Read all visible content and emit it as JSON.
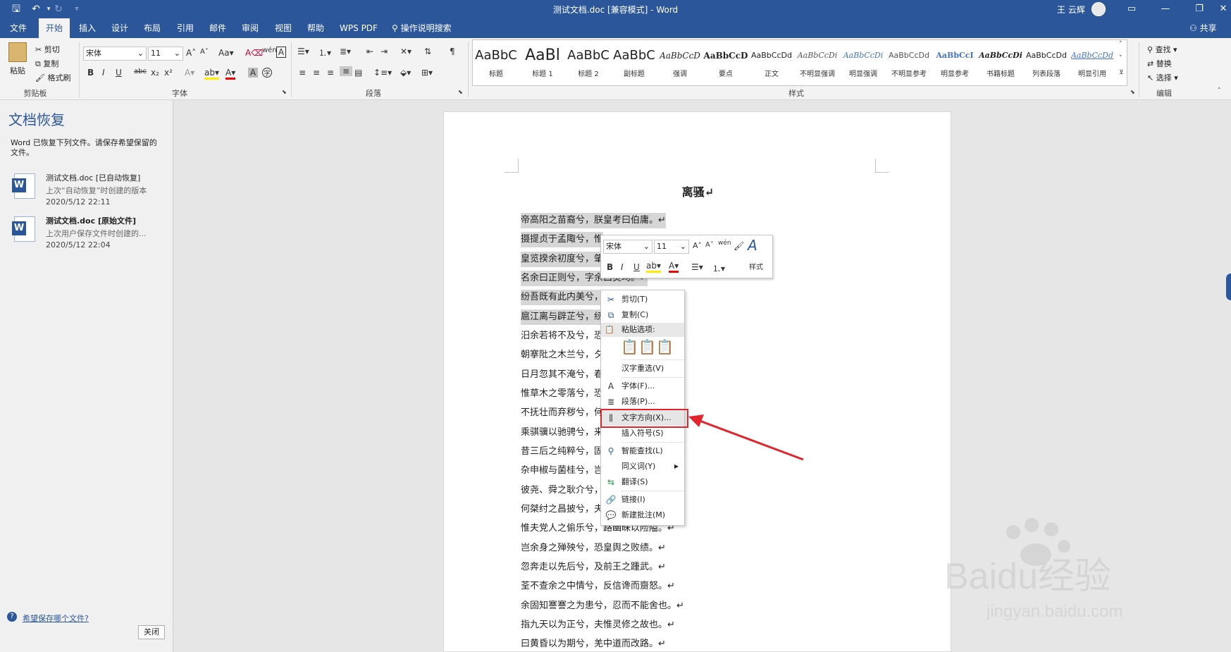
{
  "window": {
    "title": "测试文档.doc [兼容模式] - Word",
    "user": "王 云辉"
  },
  "tabs": [
    "文件",
    "开始",
    "插入",
    "设计",
    "布局",
    "引用",
    "邮件",
    "审阅",
    "视图",
    "帮助",
    "WPS PDF"
  ],
  "active_tab": "开始",
  "tell_me": "操作说明搜索",
  "share": "共享",
  "ribbon": {
    "clipboard": {
      "paste": "粘贴",
      "cut": "剪切",
      "copy": "复制",
      "format_painter": "格式刷",
      "label": "剪贴板"
    },
    "font": {
      "name": "宋体",
      "size": "11",
      "label": "字体"
    },
    "paragraph": {
      "label": "段落"
    },
    "styles": {
      "label": "样式",
      "items": [
        {
          "sample": "AaBbC",
          "name": "标题"
        },
        {
          "sample": "AaBl",
          "name": "标题 1"
        },
        {
          "sample": "AaBbC",
          "name": "标题 2"
        },
        {
          "sample": "AaBbC",
          "name": "副标题"
        },
        {
          "sample": "AaBbCcD",
          "name": "强调"
        },
        {
          "sample": "AaBbCcD",
          "name": "要点"
        },
        {
          "sample": "AaBbCcDd",
          "name": "正文"
        },
        {
          "sample": "AaBbCcDi",
          "name": "不明显强调"
        },
        {
          "sample": "AaBbCcDi",
          "name": "明显强调"
        },
        {
          "sample": "AaBbCcDd",
          "name": "不明显参考"
        },
        {
          "sample": "AaBbCcI",
          "name": "明显参考"
        },
        {
          "sample": "AaBbCcDi",
          "name": "书籍标题"
        },
        {
          "sample": "AaBbCcDd",
          "name": "列表段落"
        },
        {
          "sample": "AaBbCcDd",
          "name": "明显引用"
        }
      ]
    },
    "editing": {
      "find": "查找",
      "replace": "替换",
      "select": "选择",
      "label": "编辑"
    }
  },
  "recovery": {
    "title": "文档恢复",
    "description": "Word 已恢复下列文件。请保存希望保留的文件。",
    "items": [
      {
        "name": "测试文档.doc  [已自动恢复]",
        "sub": "上次“自动恢复”时创建的版本",
        "date": "2020/5/12 22:11"
      },
      {
        "name": "测试文档.doc  [原始文件]",
        "sub": "上次用户保存文件时创建的...",
        "date": "2020/5/12 22:04"
      }
    ],
    "help_link": "希望保存哪个文件?",
    "close": "关闭"
  },
  "document": {
    "heading": "离骚↵",
    "lines": [
      "帝高阳之苗裔兮，朕皇考曰伯庸。↵",
      "摄提贞于孟陬兮，惟",
      "皇览揆余初度兮，肇",
      "名余曰正则兮，字余曰灵均。↵",
      "纷吾既有此内美兮，",
      "扈江离与辟芷兮，纫",
      "汨余若将不及兮，恐",
      "朝搴阰之木兰兮，夕",
      "日月忽其不淹兮，春",
      "惟草木之零落兮，恐",
      "不抚壮而弃秽兮，何",
      "乘骐骥以驰骋兮，来",
      "昔三后之纯粹兮，固",
      "杂申椒与菌桂兮，岂",
      "彼尧、舜之耿介兮，",
      "何桀纣之昌披兮，夫",
      "惟夫党人之偷乐兮，路幽昧以险隘。↵",
      "岂余身之殚殃兮，恐皇舆之败绩。↵",
      "忽奔走以先后兮，及前王之踵武。↵",
      "荃不查余之中情兮，反信谗而齌怒。↵",
      "余固知謇謇之为患兮，忍而不能舍也。↵",
      "指九天以为正兮，夫惟灵修之故也。↵",
      "曰黄昏以为期兮，羌中道而改路。↵"
    ]
  },
  "mini_toolbar": {
    "font": "宋体",
    "size": "11",
    "styles": "样式"
  },
  "context_menu": {
    "cut": "剪切(T)",
    "copy": "复制(C)",
    "paste_options": "粘贴选项:",
    "hanzi_reselect": "汉字重选(V)",
    "font": "字体(F)...",
    "paragraph": "段落(P)...",
    "text_direction": "文字方向(X)...",
    "insert_symbol": "插入符号(S)",
    "smart_lookup": "智能查找(L)",
    "synonyms": "同义词(Y)",
    "translate": "翻译(S)",
    "link": "链接(I)",
    "new_comment": "新建批注(M)"
  },
  "watermark": {
    "brand": "Baidu经验",
    "url": "jingyan.baidu.com"
  },
  "colors": {
    "accent": "#2b579a",
    "highlight_red": "#e0262c"
  }
}
